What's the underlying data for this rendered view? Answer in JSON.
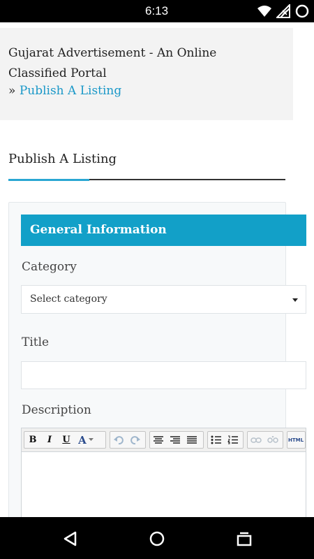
{
  "status_bar": {
    "time": "6:13",
    "icons": [
      "wifi-icon",
      "signal-icon",
      "battery-icon"
    ]
  },
  "breadcrumb": {
    "site_title": "Gujarat Advertisement - An Online Classified Portal",
    "separator": "»",
    "current": "Publish A Listing"
  },
  "page": {
    "heading": "Publish A Listing"
  },
  "form": {
    "section_title": "General Information",
    "category": {
      "label": "Category",
      "selected": "Select category"
    },
    "title": {
      "label": "Title",
      "value": ""
    },
    "description": {
      "label": "Description",
      "toolbar": {
        "bold": "B",
        "italic": "I",
        "underline": "U",
        "font_color": "A",
        "html": "HTML"
      }
    }
  },
  "nav_bar": {
    "buttons": [
      "back-icon",
      "home-icon",
      "recents-icon"
    ]
  },
  "colors": {
    "accent": "#12a0c8",
    "link": "#1a98c8",
    "breadcrumb_bg": "#f3f3f3"
  }
}
